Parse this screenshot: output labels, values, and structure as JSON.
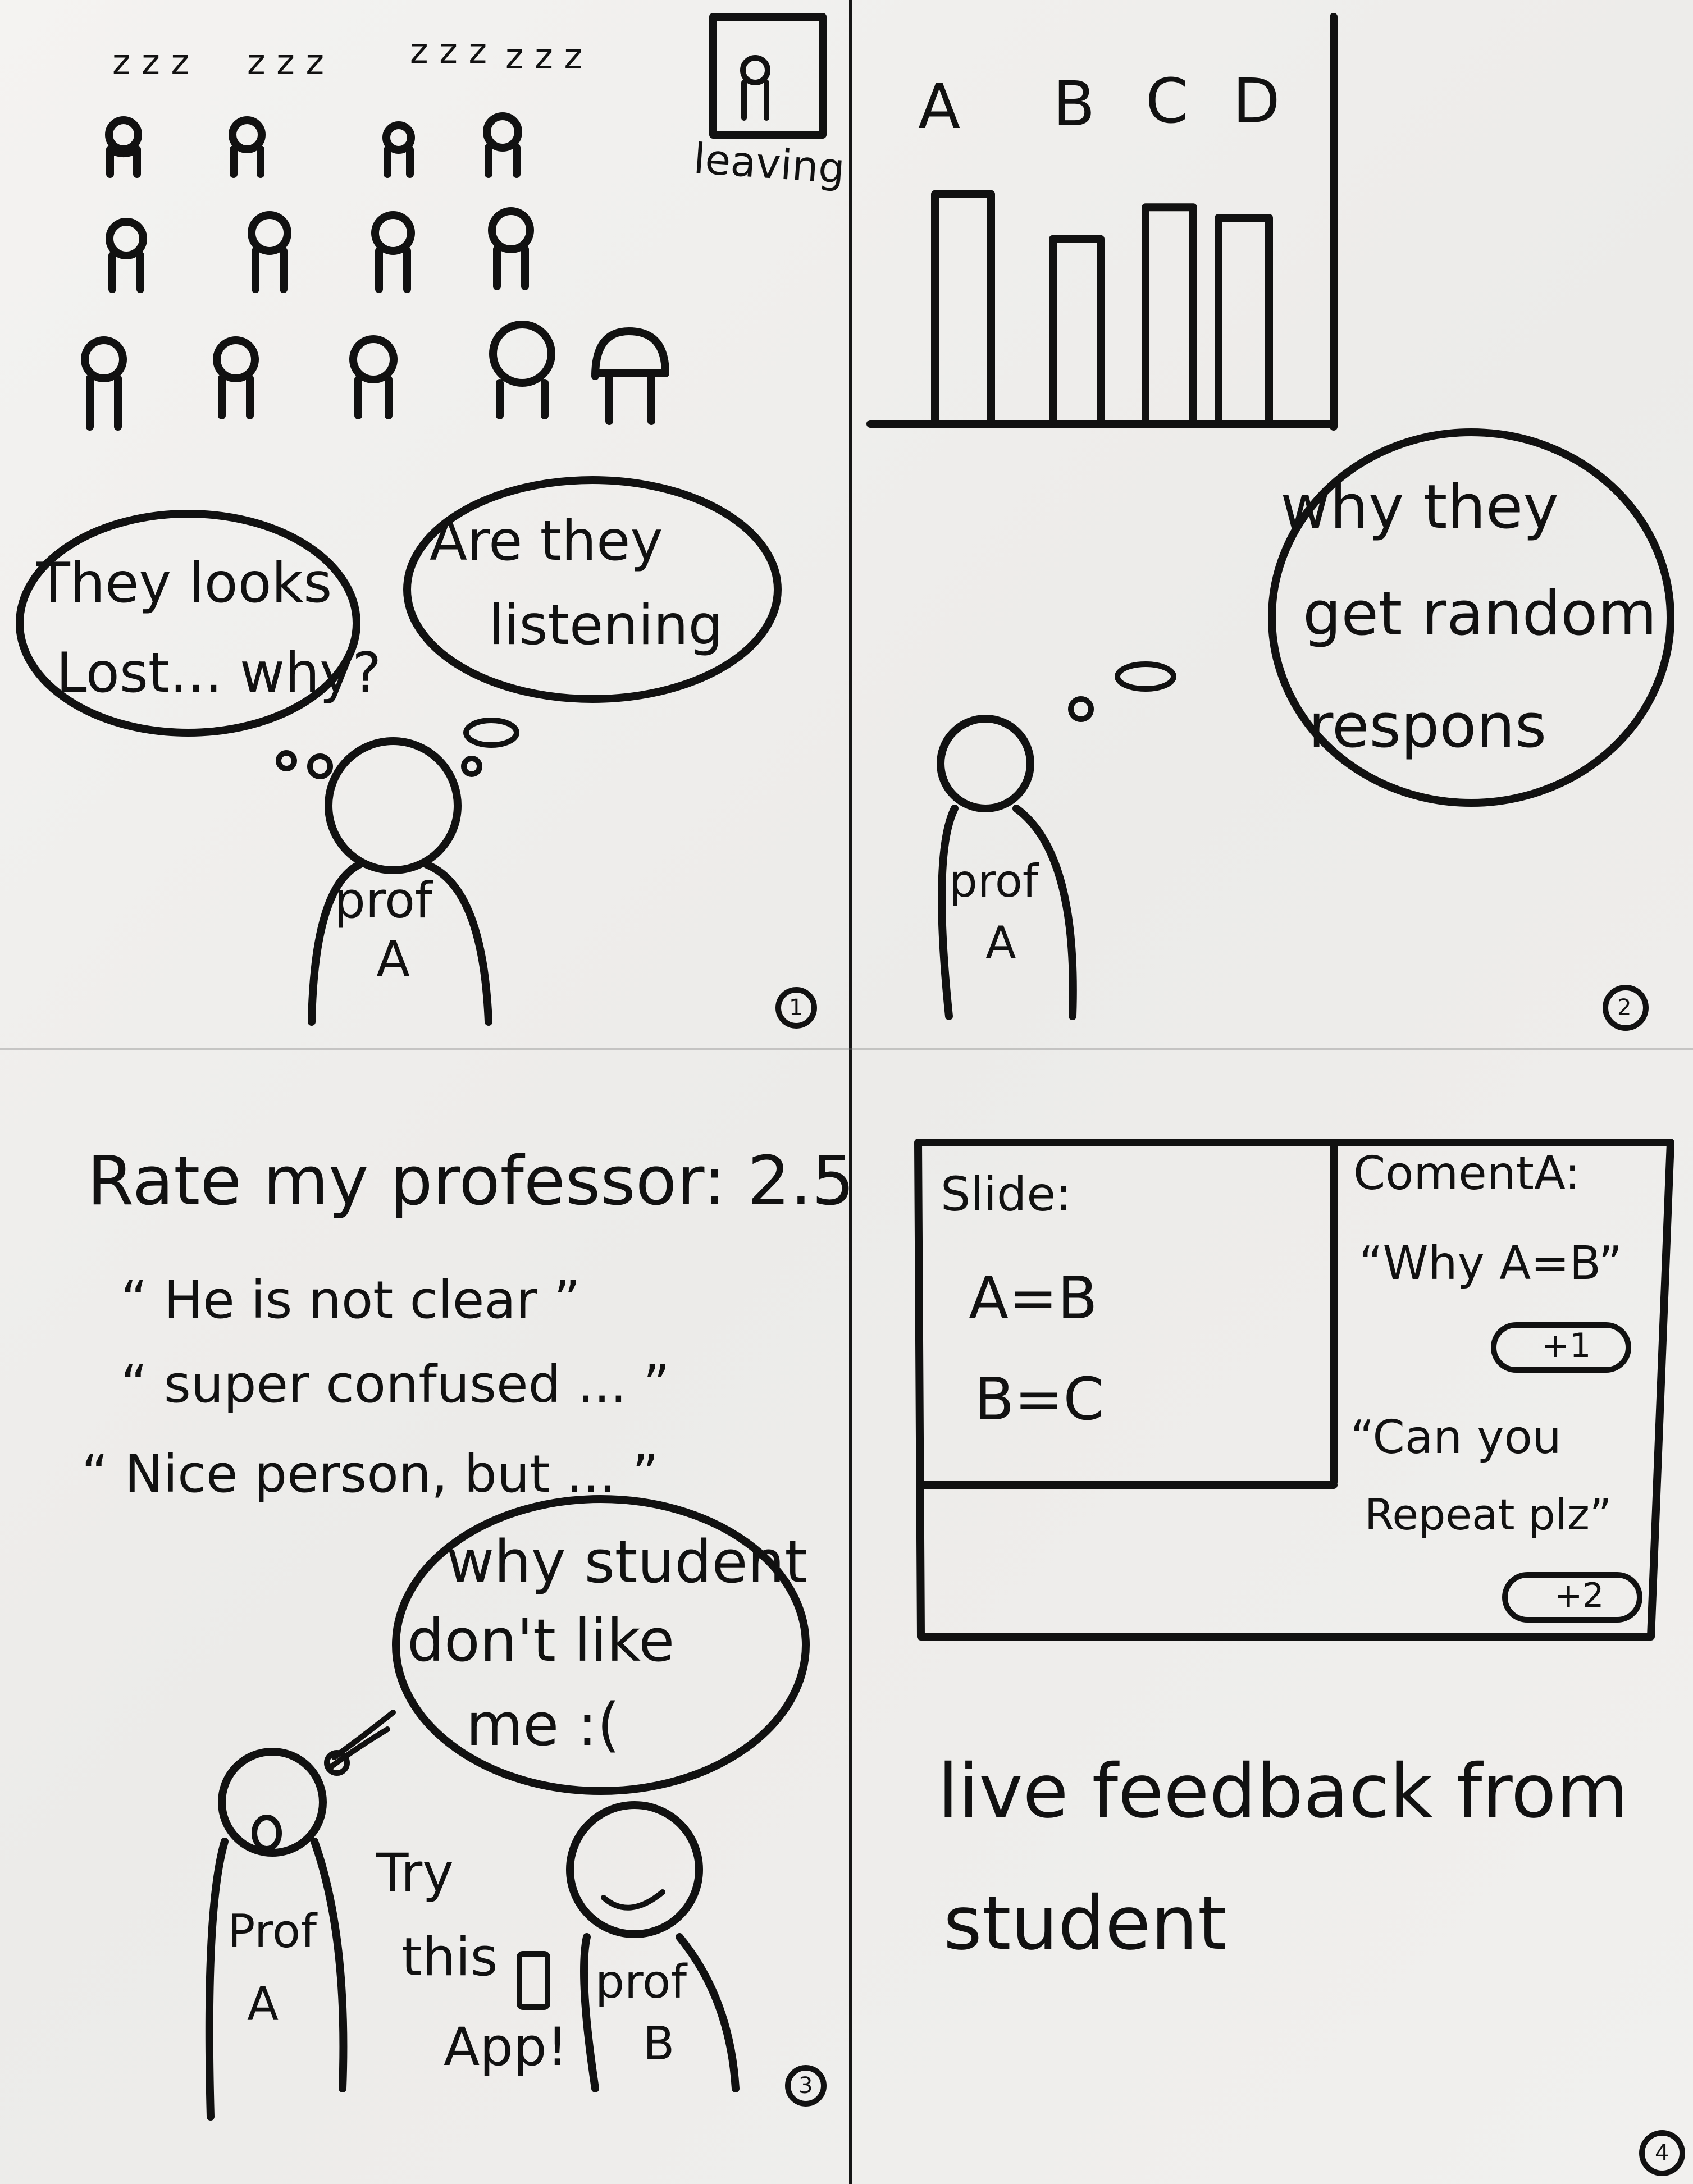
{
  "panel1": {
    "sleep_marks": [
      "z z z",
      "z z z",
      "z z z",
      "z z z"
    ],
    "leaving_label": "leaving",
    "bubble_left": [
      "They looks",
      "Lost... why?"
    ],
    "bubble_right": [
      "Are they",
      "listening"
    ],
    "prof_label": [
      "prof",
      "A"
    ],
    "number": "1"
  },
  "panel2": {
    "bar_labels": [
      "A",
      "B",
      "C",
      "D"
    ],
    "bar_values": [
      0.86,
      0.69,
      0.81,
      0.77
    ],
    "bubble": [
      "why they",
      "get random",
      "respons"
    ],
    "prof_label": [
      "prof",
      "A"
    ],
    "number": "2"
  },
  "panel3": {
    "rate_line": "Rate my professor: 2.5",
    "quotes": [
      "“ He is not clear ”",
      "“ super confused ... ”",
      "“ Nice person, but ... ”"
    ],
    "bubble": [
      "why student",
      "don't like",
      "me :("
    ],
    "prof_a": [
      "Prof",
      "A"
    ],
    "try_text": [
      "Try",
      "this",
      "App!"
    ],
    "prof_b": [
      "prof",
      "B"
    ],
    "number": "3"
  },
  "panel4": {
    "slide_label": "Slide:",
    "slide_lines": [
      "A=B",
      "B=C"
    ],
    "comment_label": "ComentA:",
    "comment1": "“Why A=B”",
    "badge1": "+1",
    "comment2": [
      "“Can you",
      "Repeat plz”"
    ],
    "badge2": "+2",
    "caption": [
      "live feedback from",
      "student"
    ],
    "number": "4"
  }
}
